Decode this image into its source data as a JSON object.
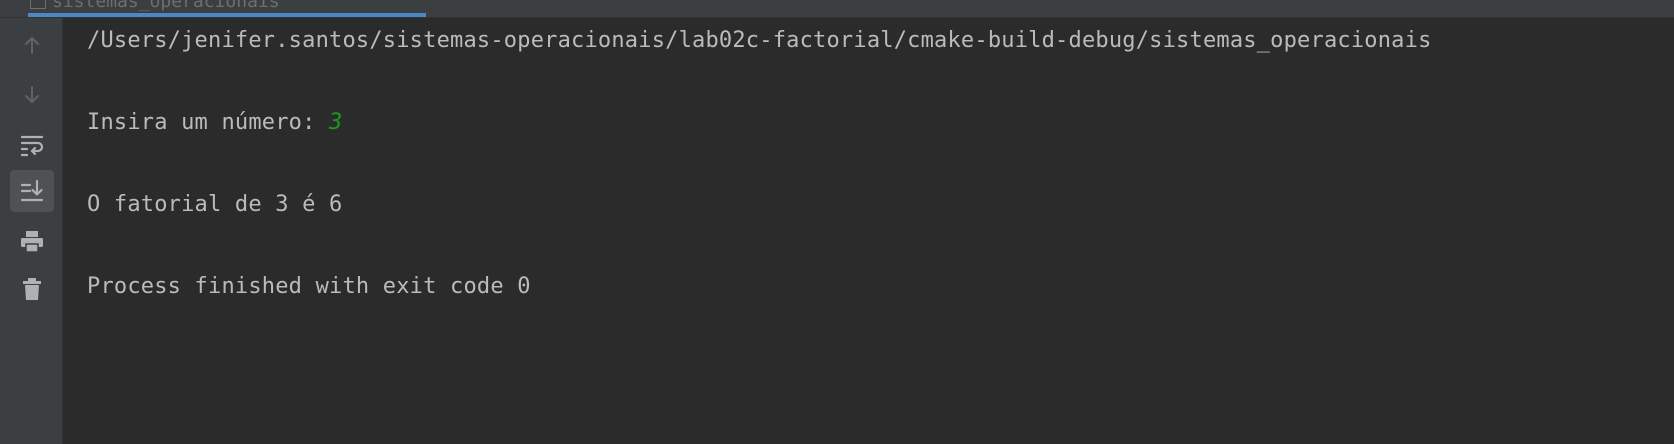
{
  "tab": {
    "label": "sistemas_operacionais"
  },
  "toolbar": {
    "items": [
      {
        "name": "up-arrow-icon"
      },
      {
        "name": "down-arrow-icon"
      },
      {
        "name": "soft-wrap-icon"
      },
      {
        "name": "scroll-to-end-icon",
        "active": true
      },
      {
        "name": "print-icon"
      },
      {
        "name": "trash-icon"
      }
    ]
  },
  "console": {
    "path": "/Users/jenifer.santos/sistemas-operacionais/lab02c-factorial/cmake-build-debug/sistemas_operacionais",
    "prompt": "Insira um número: ",
    "input_value": "3",
    "result": "O fatorial de 3 é 6",
    "exit": "Process finished with exit code 0"
  },
  "colors": {
    "background": "#2b2b2b",
    "toolbar": "#3c3f41",
    "text": "#bbbbbb",
    "input": "#199a1b",
    "accent": "#4a88c7"
  }
}
